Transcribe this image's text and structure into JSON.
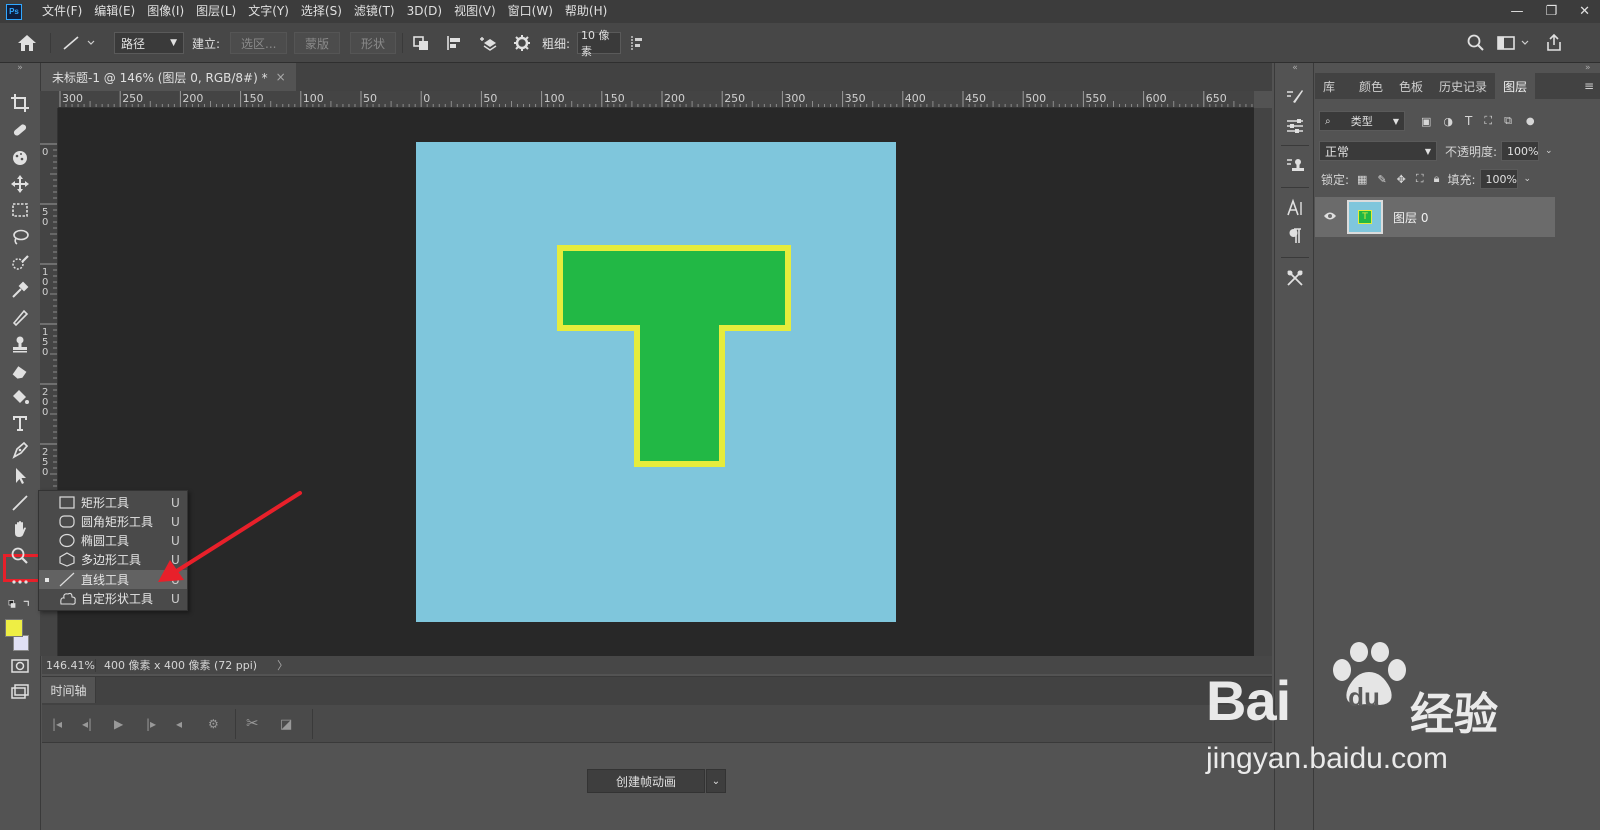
{
  "menu": {
    "logo": "Ps",
    "items": [
      "文件(F)",
      "编辑(E)",
      "图像(I)",
      "图层(L)",
      "文字(Y)",
      "选择(S)",
      "滤镜(T)",
      "3D(D)",
      "视图(V)",
      "窗口(W)",
      "帮助(H)"
    ],
    "window_controls": [
      "—",
      "❐",
      "✕"
    ]
  },
  "options": {
    "mode_value": "路径",
    "build_label": "建立:",
    "selection_btn": "选区...",
    "mask_btn": "蒙版",
    "shape_btn": "形状",
    "weight_label": "粗细:",
    "weight_value": "10 像素"
  },
  "document": {
    "tab_title": "未标题-1 @ 146% (图层 0, RGB/8#) *",
    "tab_close": "×",
    "ruler_h_labels": [
      "300",
      "250",
      "200",
      "150",
      "100",
      "50",
      "0",
      "50",
      "100",
      "150",
      "200",
      "250",
      "300",
      "350",
      "400",
      "450",
      "500",
      "550",
      "600",
      "650"
    ],
    "ruler_v_labels": [
      "0",
      "5\n0",
      "1\n0\n0",
      "1\n5\n0",
      "2\n0\n0",
      "2\n5\n0",
      "4\n0\n0"
    ],
    "zoom": "146.41%",
    "doc_info": "400 像素 x 400 像素 (72 ppi)",
    "status_arrow": "〉"
  },
  "colors": {
    "artboard": "#7fc6dc",
    "shape_fill": "#22b845",
    "shape_stroke": "#e6ec3c",
    "foreground": "#eeee44",
    "background_swatch": "#e0e0f4",
    "highlight": "#e8202a"
  },
  "flyout": {
    "items": [
      {
        "icon": "rectangle-icon",
        "label": "矩形工具",
        "key": "U",
        "selected": false
      },
      {
        "icon": "rounded-rectangle-icon",
        "label": "圆角矩形工具",
        "key": "U",
        "selected": false
      },
      {
        "icon": "ellipse-icon",
        "label": "椭圆工具",
        "key": "U",
        "selected": false
      },
      {
        "icon": "polygon-icon",
        "label": "多边形工具",
        "key": "U",
        "selected": false
      },
      {
        "icon": "line-icon",
        "label": "直线工具",
        "key": "U",
        "selected": true
      },
      {
        "icon": "custom-shape-icon",
        "label": "自定形状工具",
        "key": "U",
        "selected": false
      }
    ]
  },
  "timeline": {
    "tab_label": "时间轴",
    "create_button": "创建帧动画",
    "dropdown": "⌄"
  },
  "layers_panel": {
    "tabs": [
      "库",
      "颜色",
      "色板",
      "历史记录",
      "图层"
    ],
    "active_tab": "图层",
    "filter_type": "类型",
    "blend_mode": "正常",
    "opacity_label": "不透明度:",
    "opacity_value": "100%",
    "lock_label": "锁定:",
    "fill_label": "填充:",
    "fill_value": "100%",
    "layer_name": "图层 0",
    "layer_thumb_letter": "T"
  },
  "watermark": {
    "brand": "Bai",
    "brand_suffix": "du",
    "brand_cn": "经验",
    "url": "jingyan.baidu.com"
  }
}
